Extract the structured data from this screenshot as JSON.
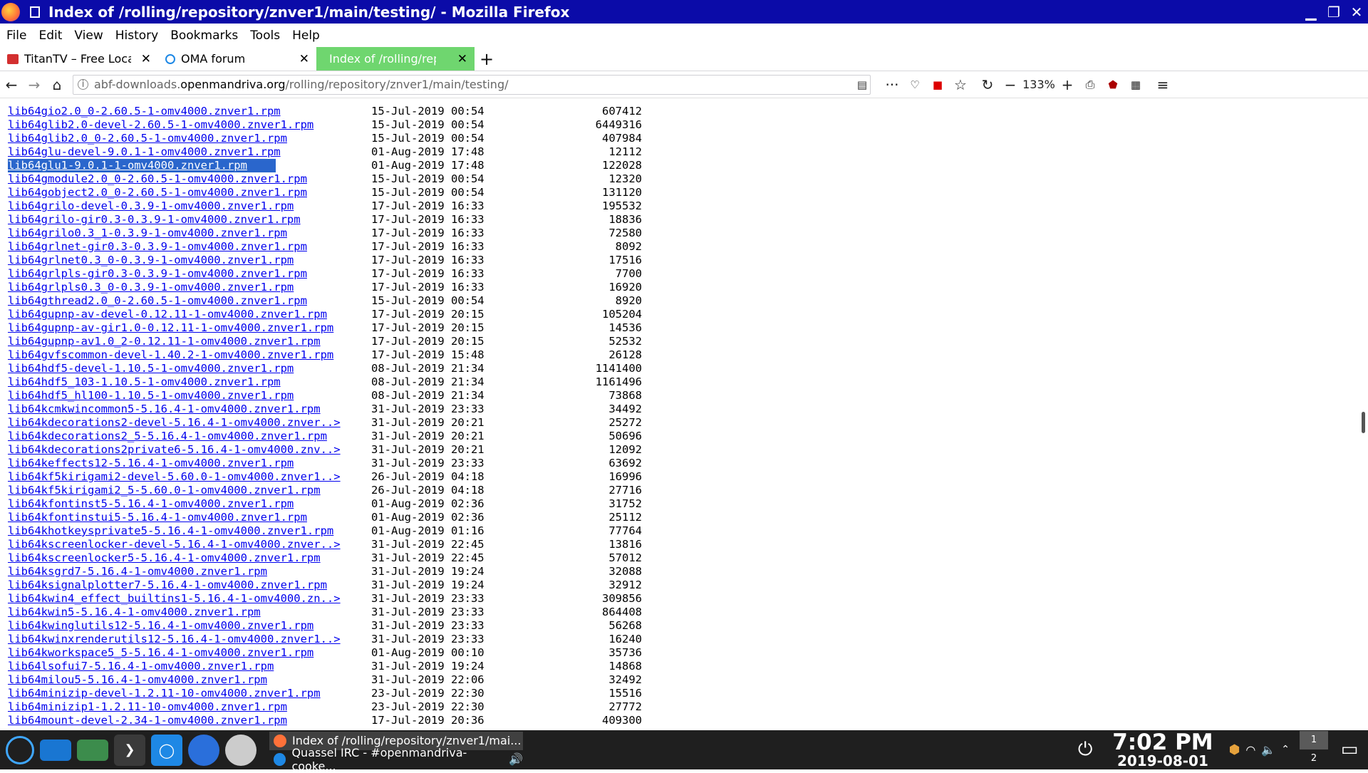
{
  "window": {
    "title": "Index of /rolling/repository/znver1/main/testing/ - Mozilla Firefox"
  },
  "menubar": [
    "File",
    "Edit",
    "View",
    "History",
    "Bookmarks",
    "Tools",
    "Help"
  ],
  "tabs": [
    {
      "label": "TitanTV – Free Local T",
      "active": false,
      "favicon_color": "#d32f2f"
    },
    {
      "label": "OMA forum",
      "active": false,
      "favicon_color": "#1e88e5"
    },
    {
      "label": "Index of /rolling/reposit",
      "active": true,
      "favicon_color": "#6fd66f"
    }
  ],
  "url": {
    "prefix": "abf-downloads.",
    "host": "openmandriva.org",
    "path": "/rolling/repository/znver1/main/testing/"
  },
  "zoom": "133%",
  "files": [
    {
      "name": "lib64gio2.0_0-2.60.5-1-omv4000.znver1.rpm",
      "date": "15-Jul-2019 00:54",
      "size": "607412"
    },
    {
      "name": "lib64glib2.0-devel-2.60.5-1-omv4000.znver1.rpm",
      "date": "15-Jul-2019 00:54",
      "size": "6449316"
    },
    {
      "name": "lib64glib2.0_0-2.60.5-1-omv4000.znver1.rpm",
      "date": "15-Jul-2019 00:54",
      "size": "407984"
    },
    {
      "name": "lib64glu-devel-9.0.1-1-omv4000.znver1.rpm",
      "date": "01-Aug-2019 17:48",
      "size": "12112"
    },
    {
      "name": "lib64glu1-9.0.1-1-omv4000.znver1.rpm",
      "date": "01-Aug-2019 17:48",
      "size": "122028",
      "selected": true
    },
    {
      "name": "lib64gmodule2.0_0-2.60.5-1-omv4000.znver1.rpm",
      "date": "15-Jul-2019 00:54",
      "size": "12320"
    },
    {
      "name": "lib64gobject2.0_0-2.60.5-1-omv4000.znver1.rpm",
      "date": "15-Jul-2019 00:54",
      "size": "131120"
    },
    {
      "name": "lib64grilo-devel-0.3.9-1-omv4000.znver1.rpm",
      "date": "17-Jul-2019 16:33",
      "size": "195532"
    },
    {
      "name": "lib64grilo-gir0.3-0.3.9-1-omv4000.znver1.rpm",
      "date": "17-Jul-2019 16:33",
      "size": "18836"
    },
    {
      "name": "lib64grilo0.3_1-0.3.9-1-omv4000.znver1.rpm",
      "date": "17-Jul-2019 16:33",
      "size": "72580"
    },
    {
      "name": "lib64grlnet-gir0.3-0.3.9-1-omv4000.znver1.rpm",
      "date": "17-Jul-2019 16:33",
      "size": "8092"
    },
    {
      "name": "lib64grlnet0.3_0-0.3.9-1-omv4000.znver1.rpm",
      "date": "17-Jul-2019 16:33",
      "size": "17516"
    },
    {
      "name": "lib64grlpls-gir0.3-0.3.9-1-omv4000.znver1.rpm",
      "date": "17-Jul-2019 16:33",
      "size": "7700"
    },
    {
      "name": "lib64grlpls0.3_0-0.3.9-1-omv4000.znver1.rpm",
      "date": "17-Jul-2019 16:33",
      "size": "16920"
    },
    {
      "name": "lib64gthread2.0_0-2.60.5-1-omv4000.znver1.rpm",
      "date": "15-Jul-2019 00:54",
      "size": "8920"
    },
    {
      "name": "lib64gupnp-av-devel-0.12.11-1-omv4000.znver1.rpm",
      "date": "17-Jul-2019 20:15",
      "size": "105204"
    },
    {
      "name": "lib64gupnp-av-gir1.0-0.12.11-1-omv4000.znver1.rpm",
      "date": "17-Jul-2019 20:15",
      "size": "14536"
    },
    {
      "name": "lib64gupnp-av1.0_2-0.12.11-1-omv4000.znver1.rpm",
      "date": "17-Jul-2019 20:15",
      "size": "52532"
    },
    {
      "name": "lib64gvfscommon-devel-1.40.2-1-omv4000.znver1.rpm",
      "date": "17-Jul-2019 15:48",
      "size": "26128"
    },
    {
      "name": "lib64hdf5-devel-1.10.5-1-omv4000.znver1.rpm",
      "date": "08-Jul-2019 21:34",
      "size": "1141400"
    },
    {
      "name": "lib64hdf5_103-1.10.5-1-omv4000.znver1.rpm",
      "date": "08-Jul-2019 21:34",
      "size": "1161496"
    },
    {
      "name": "lib64hdf5_hl100-1.10.5-1-omv4000.znver1.rpm",
      "date": "08-Jul-2019 21:34",
      "size": "73868"
    },
    {
      "name": "lib64kcmkwincommon5-5.16.4-1-omv4000.znver1.rpm",
      "date": "31-Jul-2019 23:33",
      "size": "34492"
    },
    {
      "name": "lib64kdecorations2-devel-5.16.4-1-omv4000.znver..>",
      "date": "31-Jul-2019 20:21",
      "size": "25272"
    },
    {
      "name": "lib64kdecorations2_5-5.16.4-1-omv4000.znver1.rpm",
      "date": "31-Jul-2019 20:21",
      "size": "50696"
    },
    {
      "name": "lib64kdecorations2private6-5.16.4-1-omv4000.znv..>",
      "date": "31-Jul-2019 20:21",
      "size": "12092"
    },
    {
      "name": "lib64keffects12-5.16.4-1-omv4000.znver1.rpm",
      "date": "31-Jul-2019 23:33",
      "size": "63692"
    },
    {
      "name": "lib64kf5kirigami2-devel-5.60.0-1-omv4000.znver1..>",
      "date": "26-Jul-2019 04:18",
      "size": "16996"
    },
    {
      "name": "lib64kf5kirigami2_5-5.60.0-1-omv4000.znver1.rpm",
      "date": "26-Jul-2019 04:18",
      "size": "27716"
    },
    {
      "name": "lib64kfontinst5-5.16.4-1-omv4000.znver1.rpm",
      "date": "01-Aug-2019 02:36",
      "size": "31752"
    },
    {
      "name": "lib64kfontinstui5-5.16.4-1-omv4000.znver1.rpm",
      "date": "01-Aug-2019 02:36",
      "size": "25112"
    },
    {
      "name": "lib64khotkeysprivate5-5.16.4-1-omv4000.znver1.rpm",
      "date": "01-Aug-2019 01:16",
      "size": "77764"
    },
    {
      "name": "lib64kscreenlocker-devel-5.16.4-1-omv4000.znver..>",
      "date": "31-Jul-2019 22:45",
      "size": "13816"
    },
    {
      "name": "lib64kscreenlocker5-5.16.4-1-omv4000.znver1.rpm",
      "date": "31-Jul-2019 22:45",
      "size": "57012"
    },
    {
      "name": "lib64ksgrd7-5.16.4-1-omv4000.znver1.rpm",
      "date": "31-Jul-2019 19:24",
      "size": "32088"
    },
    {
      "name": "lib64ksignalplotter7-5.16.4-1-omv4000.znver1.rpm",
      "date": "31-Jul-2019 19:24",
      "size": "32912"
    },
    {
      "name": "lib64kwin4_effect_builtins1-5.16.4-1-omv4000.zn..>",
      "date": "31-Jul-2019 23:33",
      "size": "309856"
    },
    {
      "name": "lib64kwin5-5.16.4-1-omv4000.znver1.rpm",
      "date": "31-Jul-2019 23:33",
      "size": "864408"
    },
    {
      "name": "lib64kwinglutils12-5.16.4-1-omv4000.znver1.rpm",
      "date": "31-Jul-2019 23:33",
      "size": "56268"
    },
    {
      "name": "lib64kwinxrenderutils12-5.16.4-1-omv4000.znver1..>",
      "date": "31-Jul-2019 23:33",
      "size": "16240"
    },
    {
      "name": "lib64kworkspace5_5-5.16.4-1-omv4000.znver1.rpm",
      "date": "01-Aug-2019 00:10",
      "size": "35736"
    },
    {
      "name": "lib64lsofui7-5.16.4-1-omv4000.znver1.rpm",
      "date": "31-Jul-2019 19:24",
      "size": "14868"
    },
    {
      "name": "lib64milou5-5.16.4-1-omv4000.znver1.rpm",
      "date": "31-Jul-2019 22:06",
      "size": "32492"
    },
    {
      "name": "lib64minizip-devel-1.2.11-10-omv4000.znver1.rpm",
      "date": "23-Jul-2019 22:30",
      "size": "15516"
    },
    {
      "name": "lib64minizip1-1.2.11-10-omv4000.znver1.rpm",
      "date": "23-Jul-2019 22:30",
      "size": "27772"
    },
    {
      "name": "lib64mount-devel-2.34-1-omv4000.znver1.rpm",
      "date": "17-Jul-2019 20:36",
      "size": "409300"
    }
  ],
  "taskbar": {
    "tasks": [
      {
        "label": "Index of /rolling/repository/znver1/mai...",
        "active": true
      },
      {
        "label": "Quassel IRC - #openmandriva-cooke...",
        "active": false
      }
    ],
    "time": "7:02 PM",
    "date": "2019-08-01",
    "pager": [
      "1",
      "2"
    ]
  },
  "colors": {
    "titlebar": "#0b0ba8",
    "active_tab": "#6fd66f",
    "link": "#0000ee",
    "selection": "#2a66cc",
    "taskbar": "#1f1f1f"
  }
}
